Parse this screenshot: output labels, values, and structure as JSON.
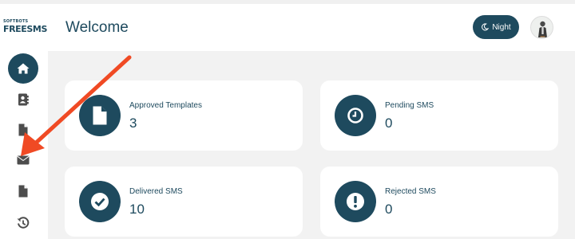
{
  "brand": {
    "small": "SOFTBOTS",
    "main": "FREESMS"
  },
  "header": {
    "title": "Welcome",
    "night_label": "Night"
  },
  "sidebar": {
    "items": [
      {
        "icon": "home-icon",
        "active": true
      },
      {
        "icon": "contacts-icon",
        "active": false
      },
      {
        "icon": "file-icon",
        "active": false
      },
      {
        "icon": "envelope-icon",
        "active": false
      },
      {
        "icon": "file-icon",
        "active": false
      },
      {
        "icon": "history-icon",
        "active": false
      }
    ]
  },
  "stats": [
    {
      "label": "Approved Templates",
      "value": "3",
      "icon": "file-icon"
    },
    {
      "label": "Pending SMS",
      "value": "0",
      "icon": "clock-icon"
    },
    {
      "label": "Delivered SMS",
      "value": "10",
      "icon": "check-circle-icon"
    },
    {
      "label": "Rejected SMS",
      "value": "0",
      "icon": "exclamation-icon"
    }
  ],
  "colors": {
    "primary": "#1e4a5e",
    "annotation_arrow": "#f04a24",
    "background": "#f2f2f2"
  }
}
